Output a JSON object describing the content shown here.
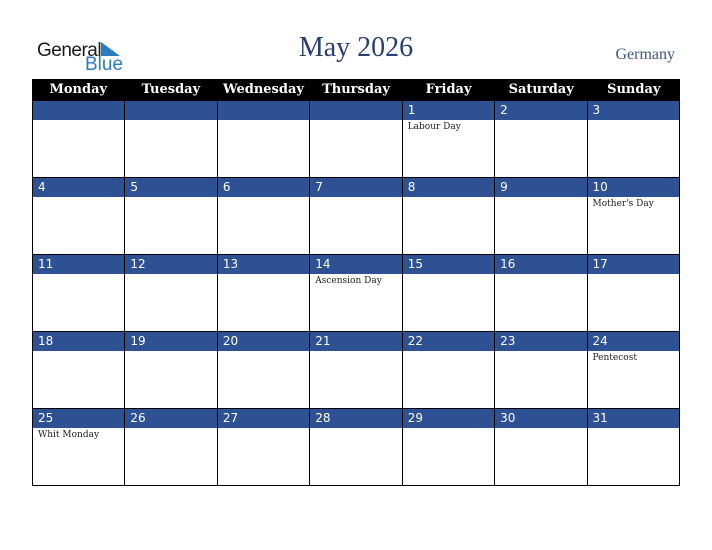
{
  "logo": {
    "general": "General",
    "blue": "Blue"
  },
  "title": "May 2026",
  "country": "Germany",
  "weekdays": [
    "Monday",
    "Tuesday",
    "Wednesday",
    "Thursday",
    "Friday",
    "Saturday",
    "Sunday"
  ],
  "weeks": [
    [
      {
        "d": "",
        "h": ""
      },
      {
        "d": "",
        "h": ""
      },
      {
        "d": "",
        "h": ""
      },
      {
        "d": "",
        "h": ""
      },
      {
        "d": "1",
        "h": "Labour Day"
      },
      {
        "d": "2",
        "h": ""
      },
      {
        "d": "3",
        "h": ""
      }
    ],
    [
      {
        "d": "4",
        "h": ""
      },
      {
        "d": "5",
        "h": ""
      },
      {
        "d": "6",
        "h": ""
      },
      {
        "d": "7",
        "h": ""
      },
      {
        "d": "8",
        "h": ""
      },
      {
        "d": "9",
        "h": ""
      },
      {
        "d": "10",
        "h": "Mother's Day"
      }
    ],
    [
      {
        "d": "11",
        "h": ""
      },
      {
        "d": "12",
        "h": ""
      },
      {
        "d": "13",
        "h": ""
      },
      {
        "d": "14",
        "h": "Ascension Day"
      },
      {
        "d": "15",
        "h": ""
      },
      {
        "d": "16",
        "h": ""
      },
      {
        "d": "17",
        "h": ""
      }
    ],
    [
      {
        "d": "18",
        "h": ""
      },
      {
        "d": "19",
        "h": ""
      },
      {
        "d": "20",
        "h": ""
      },
      {
        "d": "21",
        "h": ""
      },
      {
        "d": "22",
        "h": ""
      },
      {
        "d": "23",
        "h": ""
      },
      {
        "d": "24",
        "h": "Pentecost"
      }
    ],
    [
      {
        "d": "25",
        "h": "Whit Monday"
      },
      {
        "d": "26",
        "h": ""
      },
      {
        "d": "27",
        "h": ""
      },
      {
        "d": "28",
        "h": ""
      },
      {
        "d": "29",
        "h": ""
      },
      {
        "d": "30",
        "h": ""
      },
      {
        "d": "31",
        "h": ""
      }
    ]
  ]
}
